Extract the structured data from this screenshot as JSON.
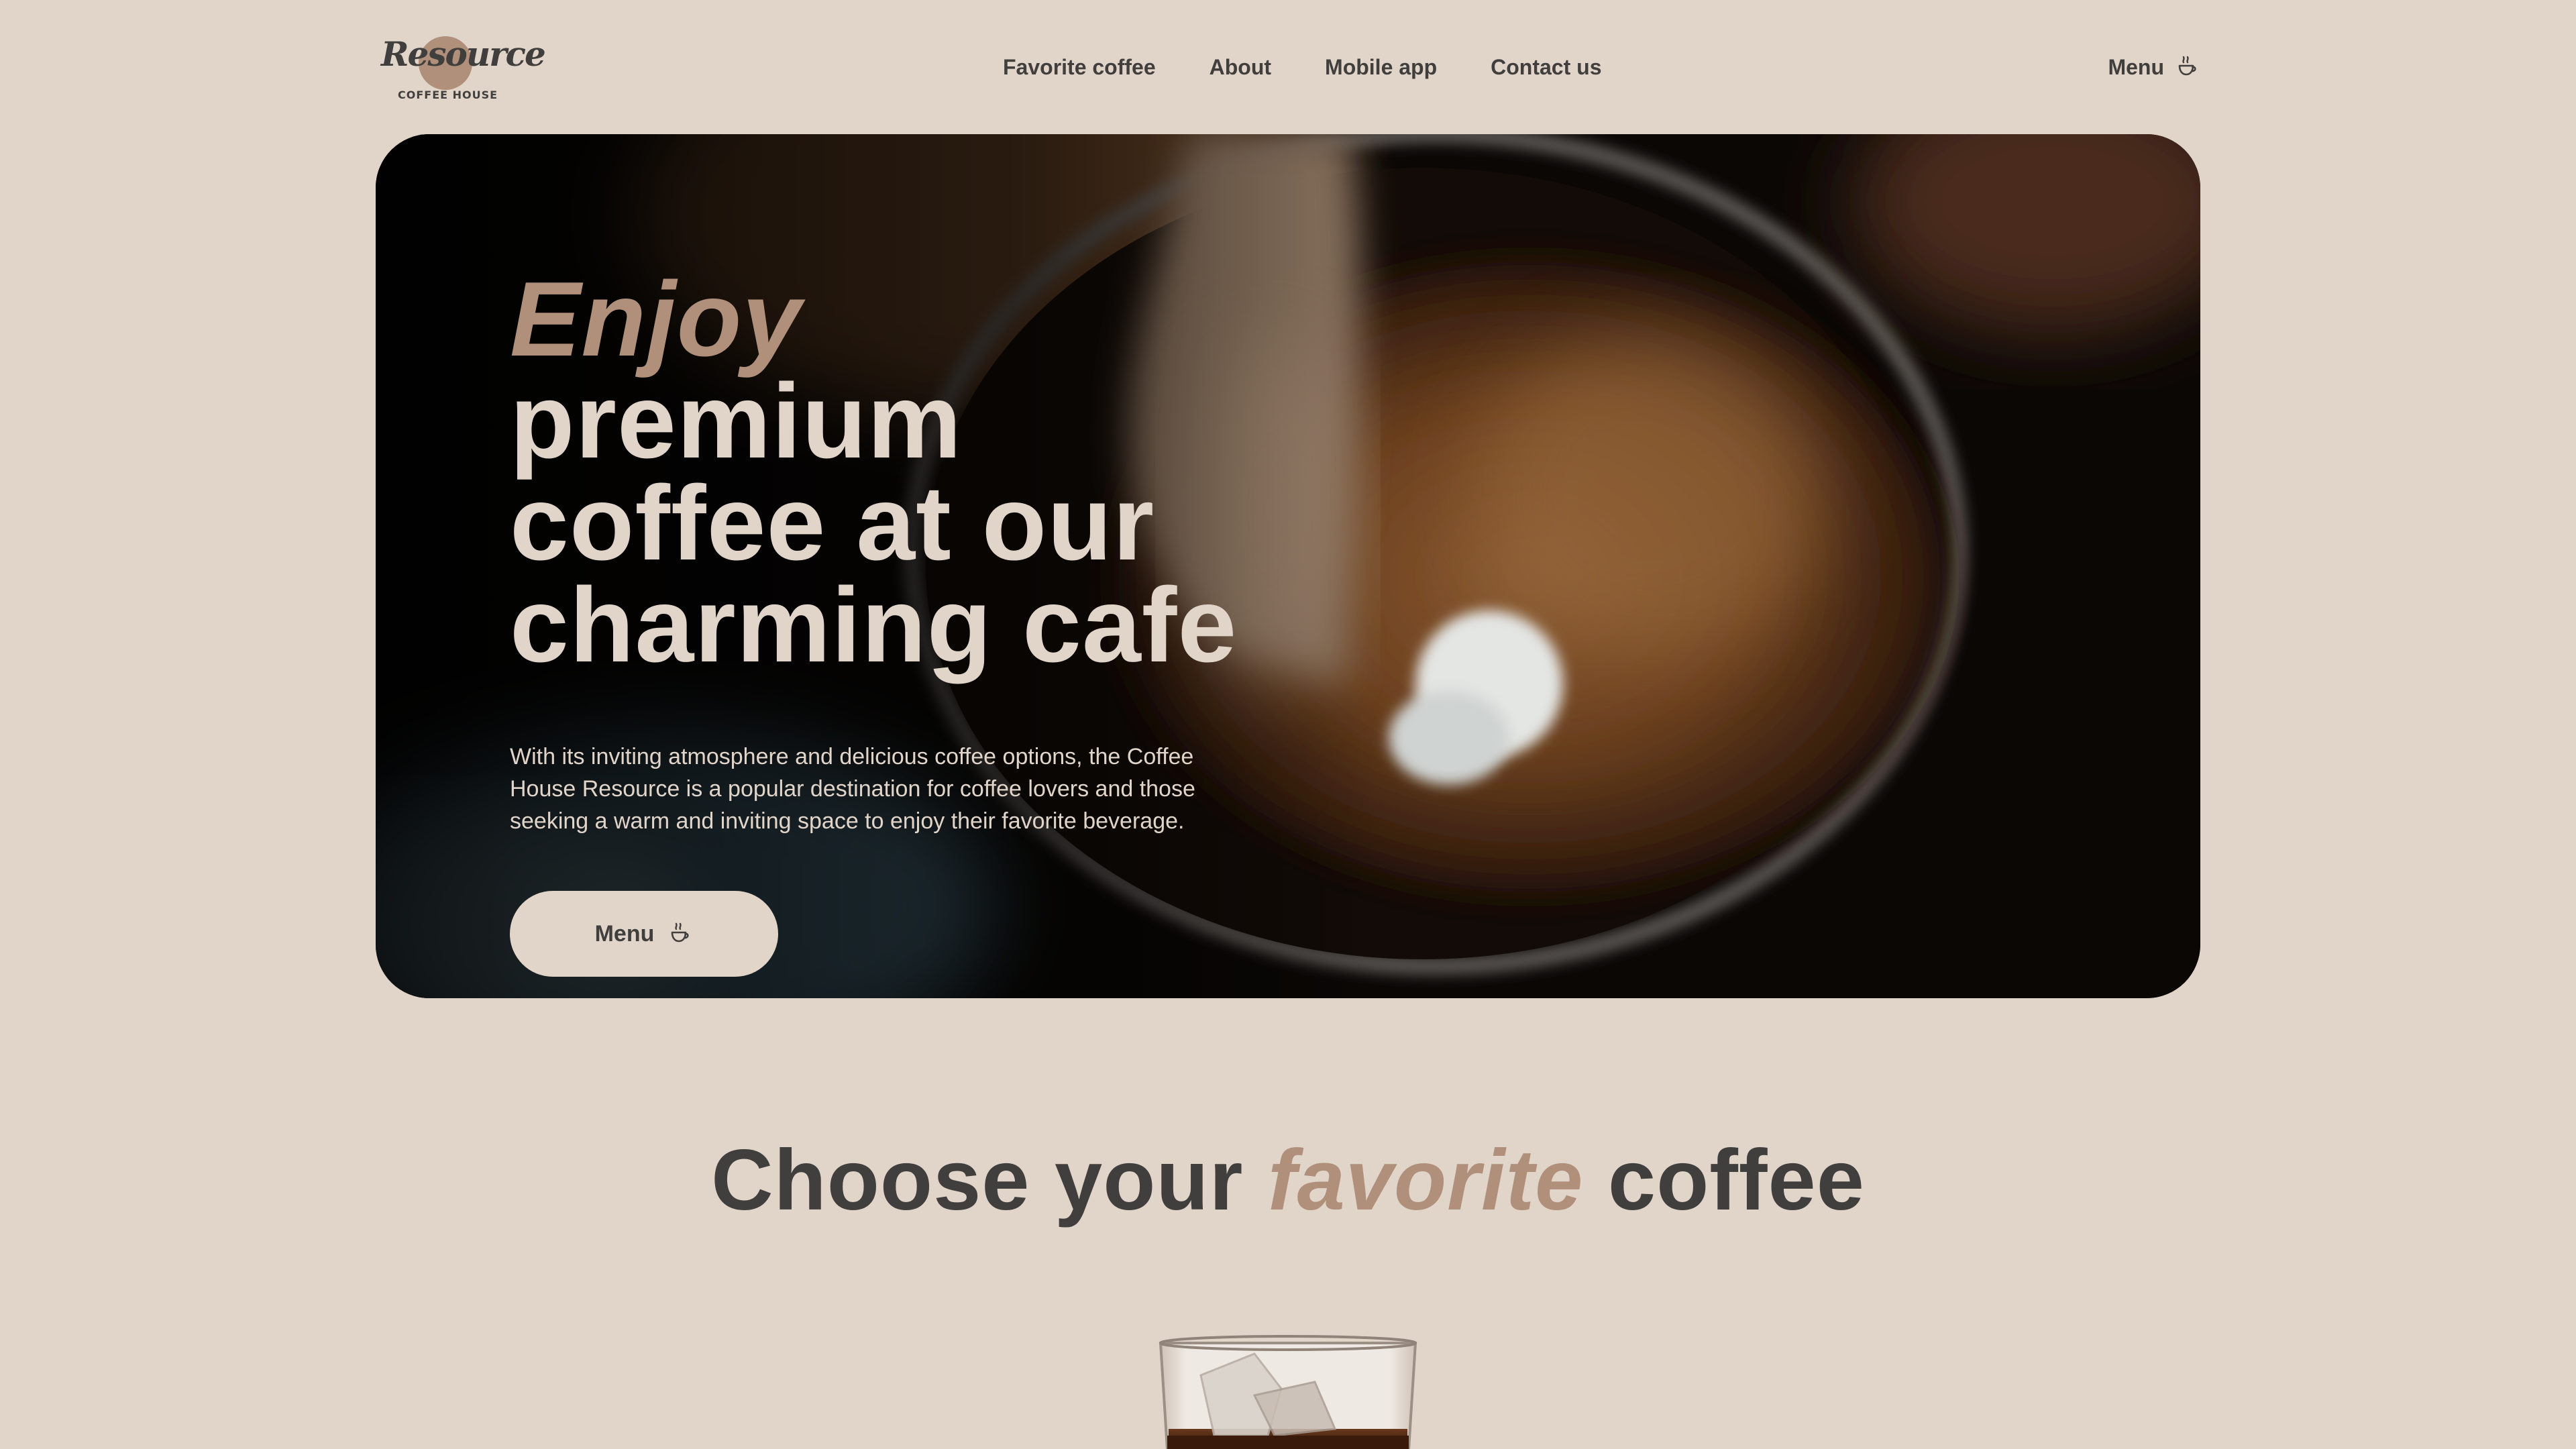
{
  "brand": {
    "logo_script": "Resource",
    "logo_subtitle": "COFFEE HOUSE"
  },
  "nav": {
    "links": [
      {
        "label": "Favorite coffee"
      },
      {
        "label": "About"
      },
      {
        "label": "Mobile app"
      },
      {
        "label": "Contact us"
      }
    ],
    "menu_label": "Menu",
    "menu_icon": "coffee-cup-icon"
  },
  "hero": {
    "title_accent": "Enjoy",
    "title_rest_1": "premium",
    "title_rest_2": "coffee at our",
    "title_rest_3": "charming cafe",
    "text": "With its inviting atmosphere and delicious coffee options, the Coffee House Resource is a popular destination for coffee lovers and those seeking a warm and inviting space to enjoy their favorite beverage.",
    "button_label": "Menu",
    "button_icon": "coffee-cup-icon",
    "background": "latte-pouring-photo"
  },
  "favorite": {
    "title_before": "Choose your",
    "title_accent": "favorite",
    "title_after": "coffee",
    "first_product_image": "iced-coffee-glass-photo"
  },
  "colors": {
    "background": "#e1d4c9",
    "text_dark": "#403f3d",
    "accent": "#b0907a",
    "text_light": "#e1d4c9"
  }
}
